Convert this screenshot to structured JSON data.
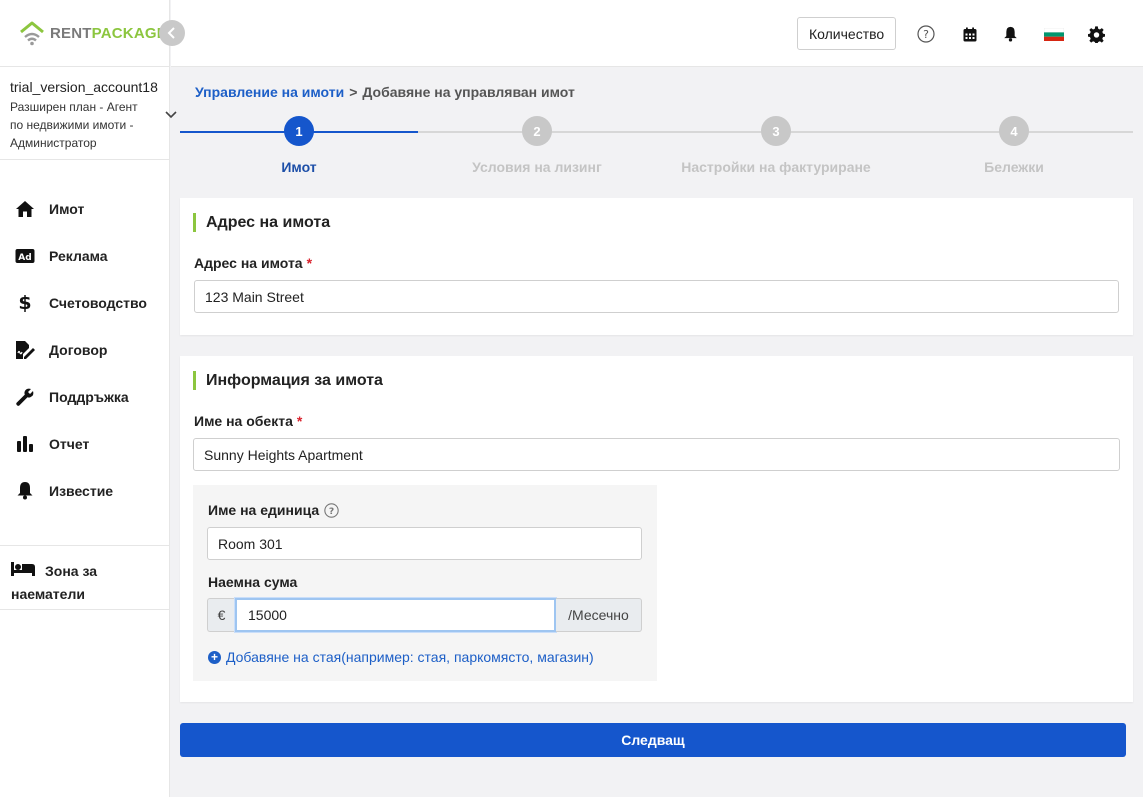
{
  "brand": {
    "rent": "RENT",
    "package": "PACKAGE"
  },
  "account": {
    "name": "trial_version_account18",
    "plan": "Разширен план - Агент по недвижими имоти - Администратор"
  },
  "nav": {
    "items": [
      {
        "label": "Имот",
        "icon": "home-icon"
      },
      {
        "label": "Реклама",
        "icon": "ad-icon"
      },
      {
        "label": "Счетоводство",
        "icon": "dollar-icon"
      },
      {
        "label": "Договор",
        "icon": "contract-icon"
      },
      {
        "label": "Поддръжка",
        "icon": "wrench-icon"
      },
      {
        "label": "Отчет",
        "icon": "bar-chart-icon"
      },
      {
        "label": "Известие",
        "icon": "bell-icon"
      }
    ],
    "tenant_zone": "Зона за наематели"
  },
  "header": {
    "quantity_label": "Количество",
    "icons": [
      "help-icon",
      "calendar-icon",
      "bell-icon",
      "bulgarian-flag-icon",
      "gear-icon"
    ]
  },
  "breadcrumb": {
    "parent": "Управление на имоти",
    "separator": ">",
    "current": "Добавяне на управляван имот"
  },
  "steps": [
    {
      "number": "1",
      "label": "Имот",
      "active": true
    },
    {
      "number": "2",
      "label": "Условия на лизинг",
      "active": false
    },
    {
      "number": "3",
      "label": "Настройки на фактуриране",
      "active": false
    },
    {
      "number": "4",
      "label": "Бележки",
      "active": false
    }
  ],
  "address_section": {
    "title": "Адрес на имота",
    "field_label": "Адрес на имота",
    "required_mark": "*",
    "value": "123 Main Street"
  },
  "info_section": {
    "title": "Информация за имота",
    "property_name_label": "Име на обекта",
    "required_mark": "*",
    "property_name_value": "Sunny Heights Apartment",
    "unit": {
      "unit_name_label": "Име на единица",
      "unit_name_value": "Room 301",
      "rent_label": "Наемна сума",
      "currency": "€",
      "rent_value": "15000",
      "period": "/Месечно",
      "add_room_label": "Добавяне на стая(например: стая, паркомясто, магазин)"
    }
  },
  "next_button": "Следващ",
  "colors": {
    "primary": "#1556cc",
    "link": "#1d5fc7",
    "accent_green": "#8cc63f",
    "required": "#d9232e",
    "step_inactive": "#c8c8c8"
  }
}
